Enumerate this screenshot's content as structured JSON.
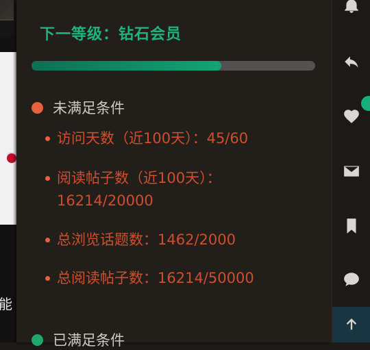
{
  "background": {
    "cut_text": "能"
  },
  "panel": {
    "level_title": "下一等级：钻石会员",
    "progress": 0.67,
    "unmet": {
      "label": "未满足条件",
      "items": [
        "访问天数（近100天）：45/60",
        "阅读帖子数（近100天）：16214/20000",
        "总浏览话题数：1462/2000",
        "总阅读帖子数：16214/50000"
      ]
    },
    "met": {
      "label": "已满足条件"
    }
  },
  "sidebar": {
    "icons": [
      "bell-icon",
      "reply-icon",
      "heart-icon",
      "mail-icon",
      "bookmark-icon",
      "chat-icon",
      "arrow-up-icon"
    ]
  },
  "colors": {
    "accent_green": "#1fb380",
    "warning_orange": "#e8603c",
    "text_red": "#cf4e2e"
  }
}
